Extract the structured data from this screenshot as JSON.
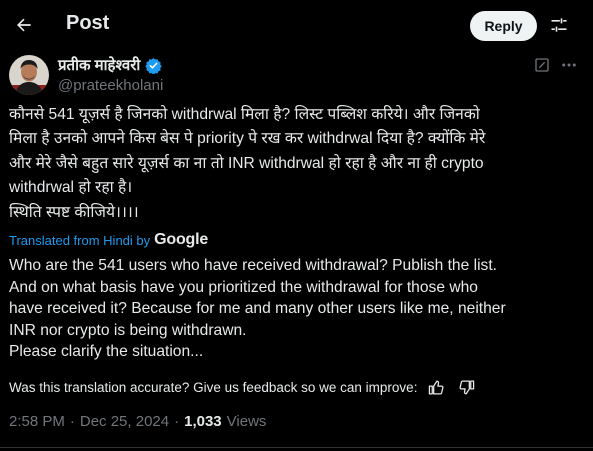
{
  "header": {
    "title": "Post",
    "reply_label": "Reply"
  },
  "author": {
    "display_name": "प्रतीक माहेश्वरी",
    "handle": "@prateekholani",
    "verified": true
  },
  "tweet": {
    "text": "कौनसे 541 यूज़र्स है जिनको withdrwal मिला है? लिस्ट पब्लिश करिये। और जिनको\nमिला है उनको आपने किस बेस पे priority पे रख कर withdrwal दिया है? क्योंकि मेरे\nऔर मेरे जैसे बहुत सारे यूज़र्स का ना तो INR withdrwal हो रहा है और ना ही crypto\nwithdrwal हो रहा है।\nस्थिति स्पष्ट कीजिये।।।।"
  },
  "translation": {
    "label": "Translated from Hindi by",
    "provider": "Google",
    "text": "Who are the 541 users who have received withdrawal? Publish the list.\nAnd on what basis have you prioritized the withdrawal for those who\nhave received it? Because for me and many other users like me, neither\nINR nor crypto is being withdrawn.\nPlease clarify the situation...",
    "feedback_prompt": "Was this translation accurate? Give us feedback so we can improve:"
  },
  "meta": {
    "time": "2:58 PM",
    "date": "Dec 25, 2024",
    "separator": "·",
    "views_count": "1,033",
    "views_label": "Views"
  },
  "colors": {
    "background": "#000000",
    "text": "#e7e9ea",
    "secondary": "#71767b",
    "link": "#1d9bf0",
    "verified": "#1d9bf0"
  },
  "icons": [
    "back-arrow-icon",
    "settings-sliders-icon",
    "verified-badge-icon",
    "edit-note-icon",
    "more-icon",
    "thumbs-up-icon",
    "thumbs-down-icon"
  ]
}
